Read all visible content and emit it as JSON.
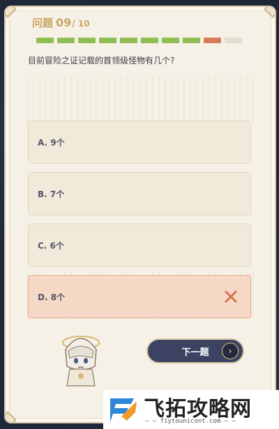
{
  "quiz": {
    "header_label": "问题",
    "current": "09",
    "total": "/ 10",
    "progress": [
      "correct",
      "correct",
      "correct",
      "correct",
      "correct",
      "correct",
      "correct",
      "correct",
      "wrong",
      "pending"
    ],
    "question": "目前冒险之证记载的首领级怪物有几个?",
    "options": [
      {
        "label": "A. 9个",
        "state": "normal"
      },
      {
        "label": "B. 7个",
        "state": "normal"
      },
      {
        "label": "C. 6个",
        "state": "normal"
      },
      {
        "label": "D. 8个",
        "state": "wrong"
      }
    ],
    "next_label": "下一题"
  },
  "colors": {
    "correct": "#8fbf52",
    "wrong": "#d77a5a",
    "pending": "#e4ddce",
    "accent": "#c9a463"
  },
  "icons": {
    "wrong_mark": "close-icon",
    "next_arrow": "chevron-right-icon"
  },
  "watermark": {
    "brand": "飞拓攻略网",
    "url": "— — fiytounicont.com — —"
  }
}
